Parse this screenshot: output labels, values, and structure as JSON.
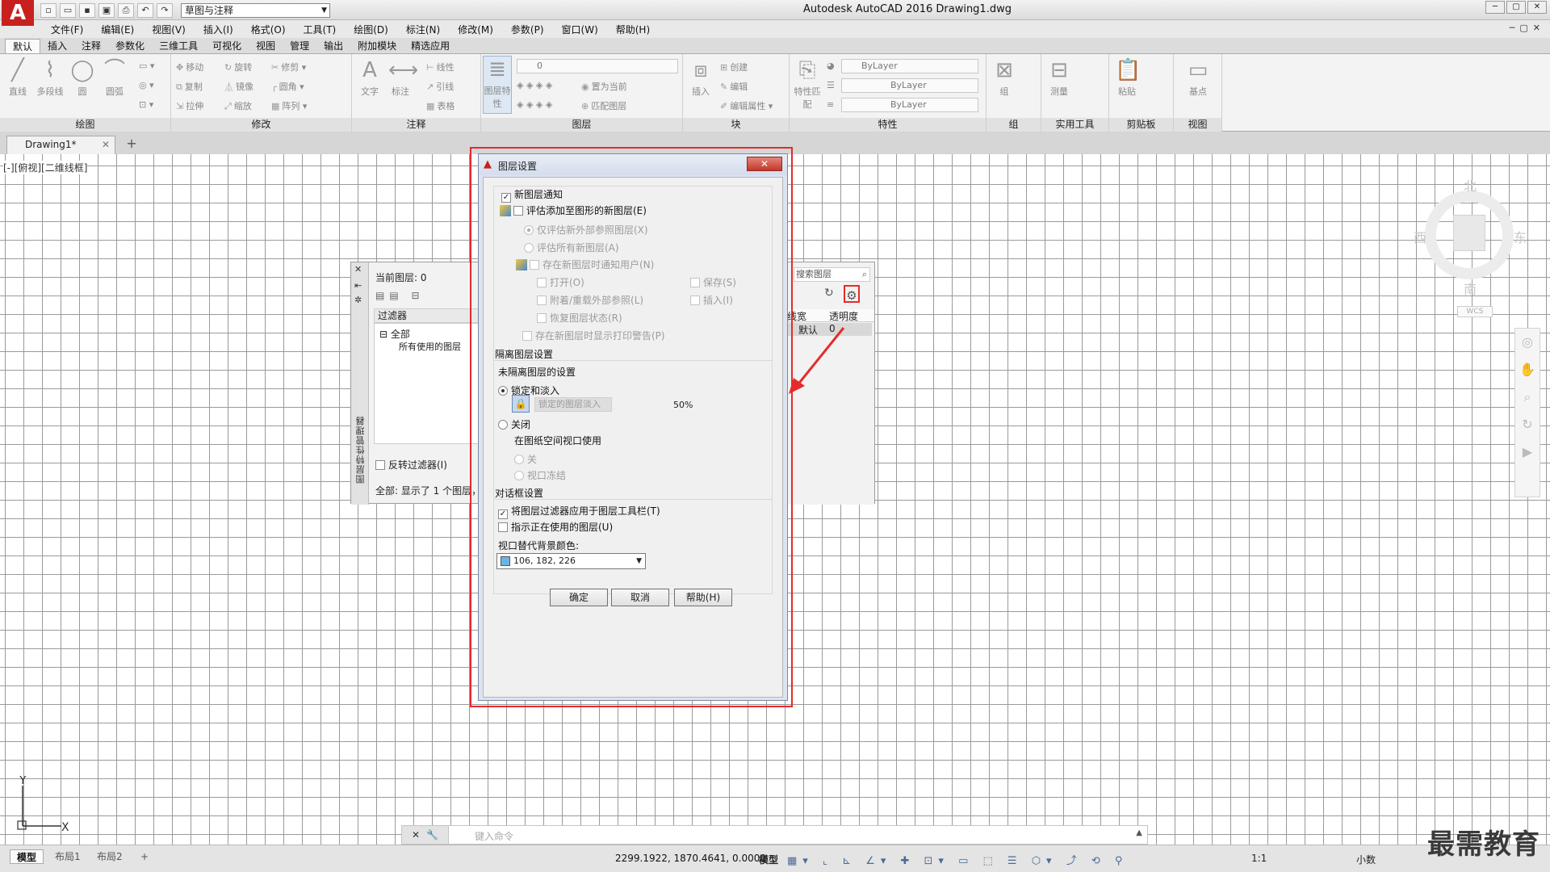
{
  "app": {
    "title": "Autodesk AutoCAD 2016    Drawing1.dwg",
    "logo": "A",
    "workspace": "草图与注释"
  },
  "menu": [
    "文件(F)",
    "编辑(E)",
    "视图(V)",
    "插入(I)",
    "格式(O)",
    "工具(T)",
    "绘图(D)",
    "标注(N)",
    "修改(M)",
    "参数(P)",
    "窗口(W)",
    "帮助(H)"
  ],
  "ribbon_tabs": [
    "默认",
    "插入",
    "注释",
    "参数化",
    "三维工具",
    "可视化",
    "视图",
    "管理",
    "输出",
    "附加模块",
    "精选应用"
  ],
  "ribbon": {
    "draw": {
      "title": "绘图",
      "line": "直线",
      "polyline": "多段线",
      "circle": "圆",
      "arc": "圆弧"
    },
    "modify": {
      "title": "修改",
      "move": "移动",
      "rotate": "旋转",
      "trim": "修剪",
      "copy": "复制",
      "mirror": "镜像",
      "fillet": "圆角",
      "stretch": "拉伸",
      "scale": "缩放",
      "array": "阵列"
    },
    "annotation": {
      "title": "注释",
      "text": "文字",
      "dimension": "标注",
      "linear": "线性",
      "leader": "引线",
      "table": "表格"
    },
    "layers": {
      "title": "图层",
      "layer_props": "图层特性",
      "current_layer": "0",
      "set_current": "置为当前",
      "match_layer": "匹配图层"
    },
    "block": {
      "title": "块",
      "insert": "插入",
      "create": "创建",
      "edit": "编辑",
      "edit_attr": "编辑属性"
    },
    "properties": {
      "title": "特性",
      "match": "特性匹配",
      "color": "ByLayer",
      "linetype": "ByLayer",
      "lineweight": "ByLayer"
    },
    "groups": {
      "title": "组",
      "group": "组"
    },
    "utilities": {
      "title": "实用工具",
      "measure": "测量"
    },
    "clipboard": {
      "title": "剪贴板",
      "paste": "粘贴"
    },
    "view": {
      "title": "视图",
      "base": "基点"
    }
  },
  "doc_tab": {
    "name": "Drawing1*",
    "close": "✕",
    "add": "+"
  },
  "viewport_label": "[-][俯视][二维线框]",
  "viewcube": {
    "north": "北",
    "south": "南",
    "east": "东",
    "west": "西",
    "top": "上",
    "wcs": "WCS"
  },
  "ucs": {
    "x": "X",
    "y": "Y"
  },
  "layer_manager": {
    "title": "图层特性管理器",
    "current_layer": "当前图层: 0",
    "filters_header": "过滤器",
    "filter_all": "全部",
    "filter_used": "所有使用的图层",
    "invert_filter": "反转过滤器(I)",
    "status": "全部: 显示了 1 个图层，共 1 个图层",
    "search_placeholder": "搜索图层",
    "col_lineweight": "线宽",
    "col_transparency": "透明度",
    "row_lineweight": "默认",
    "row_transparency": "0"
  },
  "dialog": {
    "title": "图层设置",
    "close": "✕",
    "new_layer_notification": "新图层通知",
    "evaluate_new_layers": "评估添加至图形的新图层(E)",
    "evaluate_xref_only": "仅评估新外部参照图层(X)",
    "evaluate_all": "评估所有新图层(A)",
    "notify_when_new": "存在新图层时通知用户(N)",
    "open": "打开(O)",
    "save": "保存(S)",
    "attach_reload": "附着/重载外部参照(L)",
    "insert": "插入(I)",
    "restore_state": "恢复图层状态(R)",
    "plot_warning": "存在新图层时显示打印警告(P)",
    "isolate_section": "隔离图层设置",
    "unisolated_settings": "未隔离图层的设置",
    "lock_fade": "锁定和淡入",
    "locked_fade_label": "锁定的图层淡入",
    "fade_value": "50%",
    "off": "关闭",
    "paper_space": "在图纸空间视口使用",
    "off_option": "关",
    "vp_freeze": "视口冻结",
    "dialog_section": "对话框设置",
    "apply_filter": "将图层过滤器应用于图层工具栏(T)",
    "indicate_in_use": "指示正在使用的图层(U)",
    "viewport_bg_label": "视口替代背景颜色:",
    "viewport_bg_value": "106, 182, 226",
    "ok": "确定",
    "cancel": "取消",
    "help": "帮助(H)"
  },
  "command_line": {
    "placeholder": "键入命令"
  },
  "status_bar": {
    "tabs": [
      "模型",
      "布局1",
      "布局2"
    ],
    "add": "+",
    "coords": "2299.1922, 1870.4641, 0.0000",
    "model": "模型",
    "scale": "1:1",
    "units": "小数"
  },
  "watermark": "最需教育",
  "colors": {
    "autocad_red": "#c8201e",
    "highlight_red": "#e52b2b",
    "viewport_bg": "#6ab6e2"
  }
}
